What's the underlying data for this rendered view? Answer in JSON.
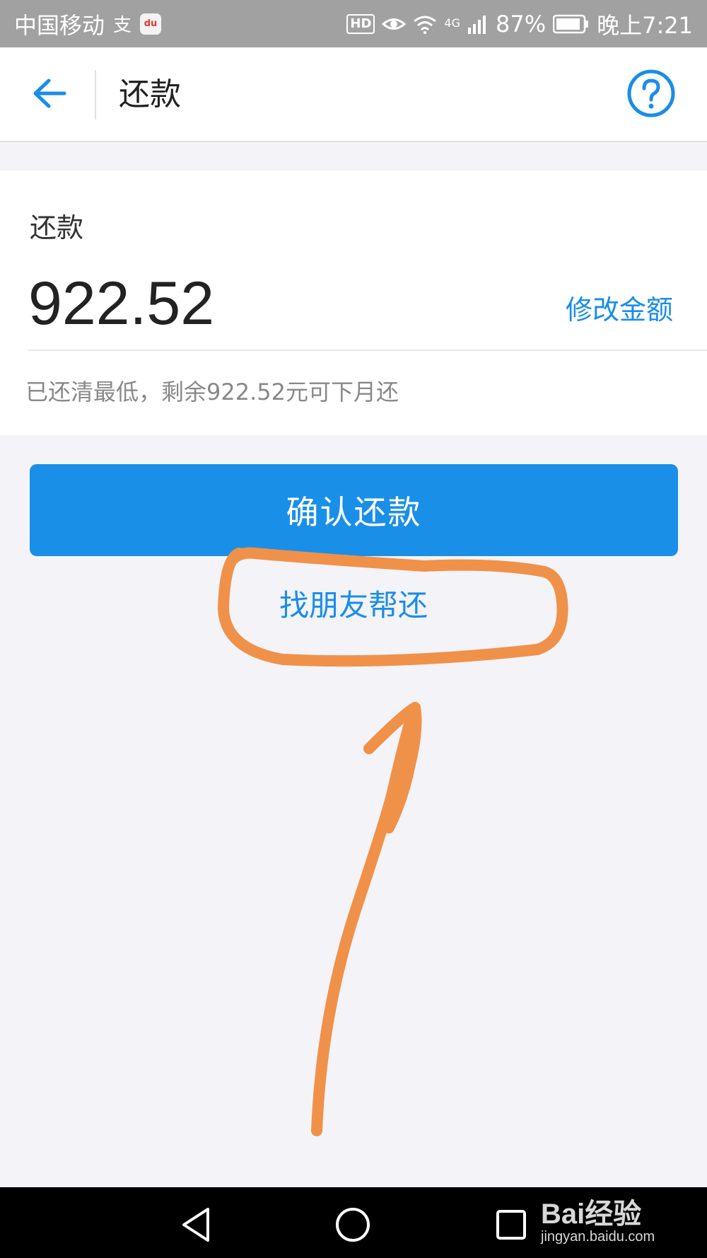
{
  "status_bar": {
    "carrier": "中国移动",
    "hd_label": "HD",
    "network_label": "4G",
    "battery_percent": "87%",
    "time": "晚上7:21"
  },
  "header": {
    "title": "还款",
    "back_icon": "back-arrow-icon",
    "help_icon": "question-circle-icon"
  },
  "repay_card": {
    "label": "还款",
    "amount": "922.52",
    "edit_link": "修改金额",
    "note": "已还清最低，剩余922.52元可下月还"
  },
  "actions": {
    "confirm_label": "确认还款",
    "friend_pay_label": "找朋友帮还"
  },
  "nav_bar": {
    "back_icon": "triangle-back-icon",
    "home_icon": "circle-home-icon",
    "recents_icon": "square-recents-icon"
  },
  "watermark": {
    "logo": "Bai经验",
    "url": "jingyan.baidu.com"
  },
  "colors": {
    "accent": "#1a8fe8",
    "annotation": "#f0914a",
    "page_bg": "#f3f3f8",
    "status_bar_bg": "#a1a1a1"
  }
}
